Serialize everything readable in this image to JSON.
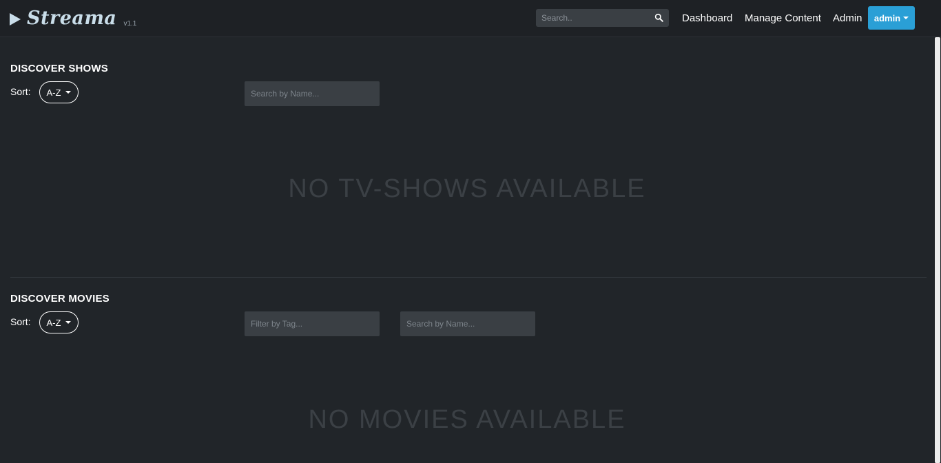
{
  "header": {
    "app_name": "Streama",
    "version": "v1.1",
    "search_placeholder": "Search..",
    "nav": {
      "dashboard": "Dashboard",
      "manage_content": "Manage Content",
      "admin": "Admin"
    },
    "user_button": "admin"
  },
  "shows": {
    "title": "DISCOVER SHOWS",
    "sort_label": "Sort:",
    "sort_value": "A-Z",
    "search_placeholder": "Search by Name...",
    "empty_message": "NO TV-SHOWS AVAILABLE"
  },
  "movies": {
    "title": "DISCOVER MOVIES",
    "sort_label": "Sort:",
    "sort_value": "A-Z",
    "tag_placeholder": "Filter by Tag...",
    "search_placeholder": "Search by Name...",
    "empty_message": "NO MOVIES AVAILABLE"
  },
  "colors": {
    "background": "#212529",
    "accent": "#2a9fd6",
    "logo": "#c9dde9"
  },
  "icons": [
    "play-icon",
    "search-icon",
    "caret-down-icon"
  ]
}
